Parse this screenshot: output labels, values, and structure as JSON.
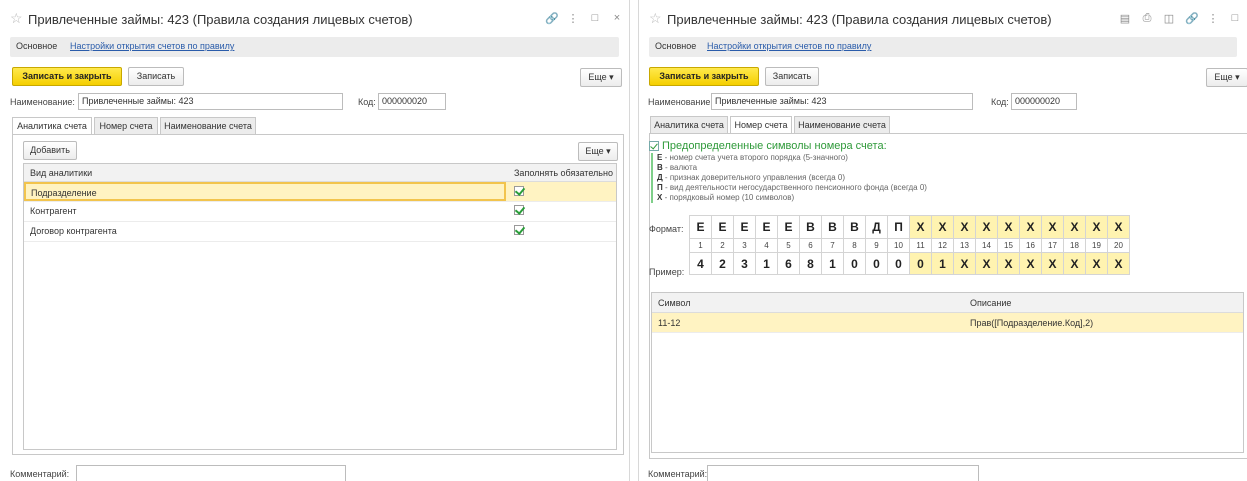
{
  "left": {
    "title": "Привлеченные займы: 423 (Правила создания лицевых счетов)",
    "nav": {
      "main": "Основное",
      "link": "Настройки открытия счетов по правилу"
    },
    "toolbar": {
      "save_close": "Записать и закрыть",
      "save": "Записать",
      "more": "Еще ▾"
    },
    "name_label": "Наименование:",
    "name_value": "Привлеченные займы: 423",
    "code_label": "Код:",
    "code_value": "000000020",
    "tabs": [
      "Аналитика счета",
      "Номер счета",
      "Наименование счета"
    ],
    "add_button": "Добавить",
    "grid_more": "Еще ▾",
    "columns": [
      "Вид аналитики",
      "Заполнять обязательно"
    ],
    "rows": [
      {
        "name": "Подразделение",
        "required": true
      },
      {
        "name": "Контрагент",
        "required": true
      },
      {
        "name": "Договор контрагента",
        "required": true
      }
    ],
    "comment_label": "Комментарий:"
  },
  "right": {
    "title": "Привлеченные займы: 423 (Правила создания лицевых счетов)",
    "nav": {
      "main": "Основное",
      "link": "Настройки открытия счетов по правилу"
    },
    "toolbar": {
      "save_close": "Записать и закрыть",
      "save": "Записать",
      "more": "Еще ▾"
    },
    "name_label": "Наименование:",
    "name_value": "Привлеченные займы: 423",
    "code_label": "Код:",
    "code_value": "000000020",
    "tabs": [
      "Аналитика счета",
      "Номер счета",
      "Наименование счета"
    ],
    "legend_title": "Предопределенные символы номера счета:",
    "legend": [
      {
        "key": "Е",
        "text": " - номер счета учета второго порядка (5-значного)"
      },
      {
        "key": "В",
        "text": " - валюта"
      },
      {
        "key": "Д",
        "text": " - признак доверительного управления (всегда 0)"
      },
      {
        "key": "П",
        "text": " - вид деятельности негосударственного пенсионного фонда (всегда 0)"
      },
      {
        "key": "Х",
        "text": " - порядковый номер (10 символов)"
      }
    ],
    "format_label": "Формат:",
    "example_label": "Пример:",
    "format": [
      "Е",
      "Е",
      "Е",
      "Е",
      "Е",
      "В",
      "В",
      "В",
      "Д",
      "П",
      "Х",
      "Х",
      "Х",
      "Х",
      "Х",
      "Х",
      "Х",
      "Х",
      "Х",
      "Х"
    ],
    "numbers": [
      "1",
      "2",
      "3",
      "4",
      "5",
      "6",
      "7",
      "8",
      "9",
      "10",
      "11",
      "12",
      "13",
      "14",
      "15",
      "16",
      "17",
      "18",
      "19",
      "20"
    ],
    "example": [
      "4",
      "2",
      "3",
      "1",
      "6",
      "8",
      "1",
      "0",
      "0",
      "0",
      "0",
      "1",
      "Х",
      "Х",
      "Х",
      "Х",
      "Х",
      "Х",
      "Х",
      "Х"
    ],
    "sym_columns": [
      "Символ",
      "Описание"
    ],
    "sym_rows": [
      {
        "symbol": "11-12",
        "description": "Прав([Подразделение.Код],2)"
      }
    ],
    "comment_label": "Комментарий:"
  },
  "colors": {
    "accent_yellow": "#f5cf00",
    "link_blue": "#2a5caa",
    "legend_green": "#2f9a3a",
    "selected_row": "#fff3c2"
  }
}
